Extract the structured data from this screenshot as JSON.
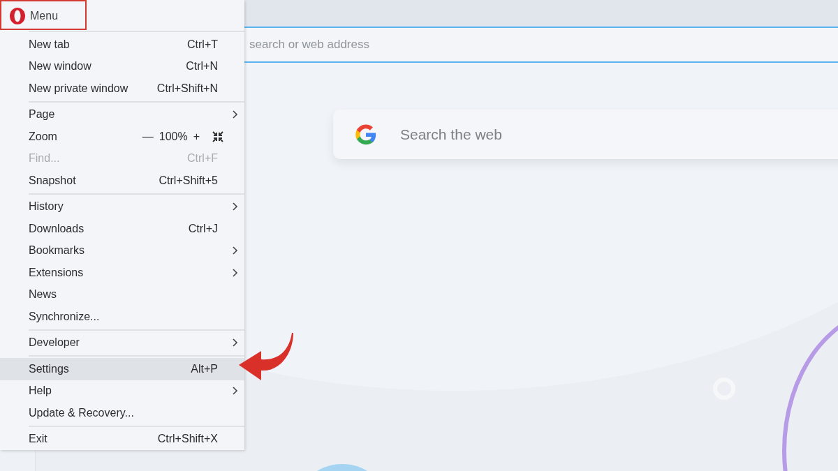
{
  "address_bar": {
    "placeholder": "search or web address"
  },
  "search_box": {
    "placeholder": "Search the web"
  },
  "menu": {
    "title": "Menu",
    "groups": [
      {
        "items": [
          {
            "kind": "item",
            "label": "New tab",
            "shortcut": "Ctrl+T",
            "disabled": false,
            "selected": false
          },
          {
            "kind": "item",
            "label": "New window",
            "shortcut": "Ctrl+N",
            "disabled": false,
            "selected": false
          },
          {
            "kind": "item",
            "label": "New private window",
            "shortcut": "Ctrl+Shift+N",
            "disabled": false,
            "selected": false
          }
        ]
      },
      {
        "items": [
          {
            "kind": "submenu",
            "label": "Page",
            "disabled": false,
            "selected": false
          },
          {
            "kind": "zoom",
            "label": "Zoom",
            "minus": "—",
            "value": "100%",
            "plus": "+",
            "disabled": false,
            "selected": false
          },
          {
            "kind": "item",
            "label": "Find...",
            "shortcut": "Ctrl+F",
            "disabled": true,
            "selected": false
          },
          {
            "kind": "item",
            "label": "Snapshot",
            "shortcut": "Ctrl+Shift+5",
            "disabled": false,
            "selected": false
          }
        ]
      },
      {
        "items": [
          {
            "kind": "submenu",
            "label": "History",
            "disabled": false,
            "selected": false
          },
          {
            "kind": "item",
            "label": "Downloads",
            "shortcut": "Ctrl+J",
            "disabled": false,
            "selected": false
          },
          {
            "kind": "submenu",
            "label": "Bookmarks",
            "disabled": false,
            "selected": false
          },
          {
            "kind": "submenu",
            "label": "Extensions",
            "disabled": false,
            "selected": false
          },
          {
            "kind": "item",
            "label": "News",
            "disabled": false,
            "selected": false
          },
          {
            "kind": "item",
            "label": "Synchronize...",
            "disabled": false,
            "selected": false
          }
        ]
      },
      {
        "items": [
          {
            "kind": "submenu",
            "label": "Developer",
            "disabled": false,
            "selected": false
          }
        ]
      },
      {
        "items": [
          {
            "kind": "item",
            "label": "Settings",
            "shortcut": "Alt+P",
            "disabled": false,
            "selected": true
          },
          {
            "kind": "submenu",
            "label": "Help",
            "disabled": false,
            "selected": false
          },
          {
            "kind": "item",
            "label": "Update & Recovery...",
            "disabled": false,
            "selected": false
          }
        ]
      },
      {
        "items": [
          {
            "kind": "item",
            "label": "Exit",
            "shortcut": "Ctrl+Shift+X",
            "disabled": false,
            "selected": false
          }
        ]
      }
    ]
  }
}
